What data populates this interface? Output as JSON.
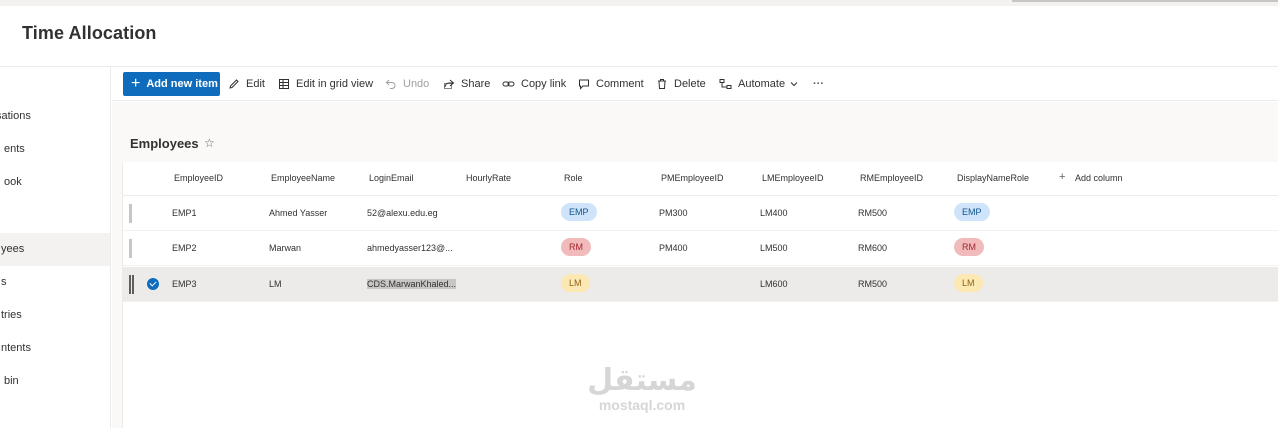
{
  "app": {
    "site_title": "Time Allocation"
  },
  "leftnav": {
    "items": [
      {
        "label": "sations",
        "selected": false
      },
      {
        "label": "ents",
        "selected": false
      },
      {
        "label": "ook",
        "selected": false
      },
      {
        "label": "",
        "selected": false
      },
      {
        "label": "yees",
        "selected": true
      },
      {
        "label": "s",
        "selected": false
      },
      {
        "label": "tries",
        "selected": false
      },
      {
        "label": "ntents",
        "selected": false
      },
      {
        "label": "bin",
        "selected": false
      }
    ]
  },
  "toolbar": {
    "add_new_item": "Add new item",
    "edit": "Edit",
    "edit_grid": "Edit in grid view",
    "undo": "Undo",
    "share": "Share",
    "copy_link": "Copy link",
    "comment": "Comment",
    "delete": "Delete",
    "automate": "Automate",
    "more": "···"
  },
  "list": {
    "title": "Employees",
    "favorite_icon": "star-icon"
  },
  "columns": [
    "EmployeeID",
    "EmployeeName",
    "LoginEmail",
    "HourlyRate",
    "Role",
    "PMEmployeeID",
    "LMEmployeeID",
    "RMEmployeeID",
    "DisplayNameRole",
    "Add column"
  ],
  "rows": [
    {
      "EmployeeID": "EMP1",
      "EmployeeName": "Ahmed Yasser",
      "LoginEmail": "52@alexu.edu.eg",
      "HourlyRate": "",
      "Role": "EMP",
      "PMEmployeeID": "PM300",
      "LMEmployeeID": "LM400",
      "RMEmployeeID": "RM500",
      "DisplayNameRole": "EMP",
      "selected": false
    },
    {
      "EmployeeID": "EMP2",
      "EmployeeName": "Marwan",
      "LoginEmail": "ahmedyasser123@...",
      "HourlyRate": "",
      "Role": "RM",
      "PMEmployeeID": "PM400",
      "LMEmployeeID": "LM500",
      "RMEmployeeID": "RM600",
      "DisplayNameRole": "RM",
      "selected": false
    },
    {
      "EmployeeID": "EMP3",
      "EmployeeName": "LM",
      "LoginEmail": "CDS.MarwanKhaled...",
      "HourlyRate": "",
      "Role": "LM",
      "PMEmployeeID": "",
      "LMEmployeeID": "LM600",
      "RMEmployeeID": "RM500",
      "DisplayNameRole": "LM",
      "selected": true
    }
  ],
  "role_colors": {
    "EMP": {
      "bg": "#cfe4fa",
      "fg": "#0f548c"
    },
    "RM": {
      "bg": "#f1bbbc",
      "fg": "#a4262c"
    },
    "LM": {
      "bg": "#fce8b2",
      "fg": "#8a6116"
    }
  },
  "accent_color": "#0f6cbd",
  "watermark": {
    "arabic": "مستقل",
    "latin": "mostaql.com"
  }
}
